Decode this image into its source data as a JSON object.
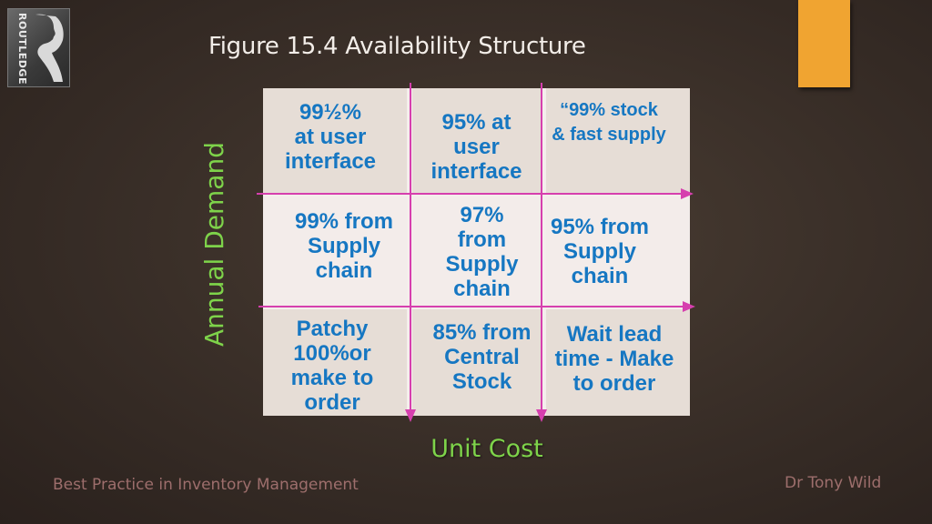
{
  "logo": {
    "publisher": "ROUTLEDGE"
  },
  "slide": {
    "title": "Figure 15.4 Availability Structure",
    "y_axis_label": "Annual Demand",
    "x_axis_label": "Unit Cost",
    "accent_color": "#f0a431",
    "axis_label_color": "#7ed34a",
    "cell_text_color": "#1677c2",
    "grid_line_color": "#d63fae"
  },
  "matrix": {
    "rows": [
      {
        "cells": [
          {
            "text": "99½%\nat user\ninterface"
          },
          {
            "text": "95% at\nuser\ninterface"
          },
          {
            "text": "“99% stock\n& fast supply"
          }
        ]
      },
      {
        "cells": [
          {
            "text": "99% from\nSupply\nchain"
          },
          {
            "text": "97%\nfrom\nSupply\nchain"
          },
          {
            "text": "95% from\nSupply\nchain"
          }
        ]
      },
      {
        "cells": [
          {
            "text": "Patchy\n100%or\nmake to\norder"
          },
          {
            "text": "85% from\nCentral\nStock"
          },
          {
            "text": "Wait lead\ntime - Make\nto order"
          }
        ]
      }
    ]
  },
  "footer": {
    "left": "Best Practice in Inventory Management",
    "right": "Dr Tony Wild"
  }
}
